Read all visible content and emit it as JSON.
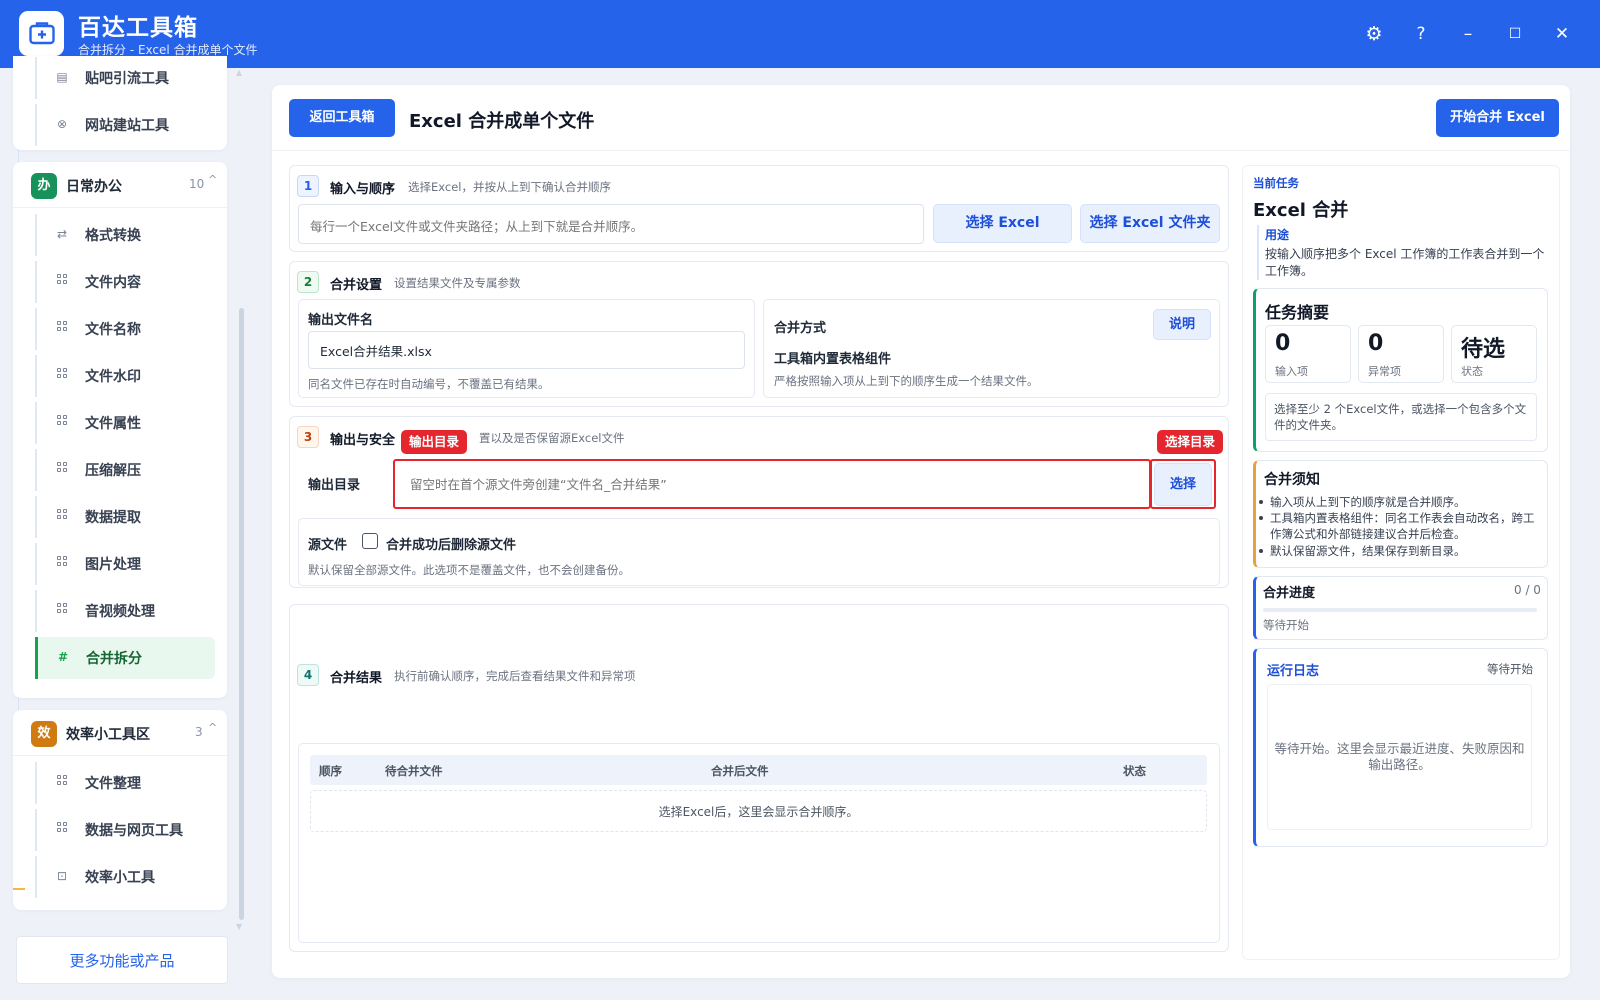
{
  "app": {
    "title": "百达工具箱",
    "subtitle": "合并拆分 - Excel 合并成单个文件"
  },
  "window_controls": {
    "settings": "⚙",
    "help": "?",
    "minimize": "–",
    "maximize": "☐",
    "close": "✕"
  },
  "sidebar": {
    "top_items": [
      "贴吧引流工具",
      "网站建站工具"
    ],
    "categories": [
      {
        "badge": "办",
        "badge_color": "#16925a",
        "name": "日常办公",
        "count": "10",
        "items": [
          "格式转换",
          "文件内容",
          "文件名称",
          "文件水印",
          "文件属性",
          "压缩解压",
          "数据提取",
          "图片处理",
          "音视频处理",
          "合并拆分"
        ],
        "active_item": "合并拆分"
      },
      {
        "badge": "效",
        "badge_color": "#d07b12",
        "name": "效率小工具区",
        "count": "3",
        "items": [
          "文件整理",
          "数据与网页工具",
          "效率小工具"
        ]
      }
    ],
    "more_button": "更多功能或产品"
  },
  "main": {
    "back_button": "返回工具箱",
    "title": "Excel 合并成单个文件",
    "start_button": "开始合并 Excel",
    "sections": {
      "input": {
        "num": "1",
        "title": "输入与顺序",
        "desc": "选择Excel，并按从上到下确认合并顺序",
        "placeholder": "每行一个Excel文件或文件夹路径；从上到下就是合并顺序。",
        "select_excel": "选择 Excel",
        "select_folder": "选择 Excel 文件夹"
      },
      "settings": {
        "num": "2",
        "title": "合并设置",
        "desc": "设置结果文件及专属参数",
        "output_name_label": "输出文件名",
        "output_name_value": "Excel合并结果.xlsx",
        "output_name_hint": "同名文件已存在时自动编号，不覆盖已有结果。",
        "method_label": "合并方式",
        "explain_button": "说明",
        "method_value": "工具箱内置表格组件",
        "method_hint": "严格按照输入项从上到下的顺序生成一个结果文件。"
      },
      "output": {
        "num": "3",
        "title": "输出与安全",
        "desc": "置以及是否保留源Excel文件",
        "tag_dir": "输出目录",
        "tag_select": "选择目录",
        "dir_label": "输出目录",
        "dir_placeholder": "留空时在首个源文件旁创建“文件名_合并结果”",
        "select_button": "选择",
        "source_label": "源文件",
        "delete_label": "合并成功后删除源文件",
        "source_hint": "默认保留全部源文件。此选项不是覆盖文件，也不会创建备份。"
      },
      "result": {
        "num": "4",
        "title": "合并结果",
        "desc": "执行前确认顺序，完成后查看结果文件和异常项",
        "columns": [
          "顺序",
          "待合并文件",
          "合并后文件",
          "状态"
        ],
        "empty": "选择Excel后，这里会显示合并顺序。"
      }
    }
  },
  "right_panel": {
    "current_task_label": "当前任务",
    "task_title": "Excel 合并",
    "usage_label": "用途",
    "usage_text": "按输入顺序把多个 Excel 工作簿的工作表合并到一个工作簿。",
    "summary_title": "任务摘要",
    "stats": [
      {
        "value": "0",
        "label": "输入项"
      },
      {
        "value": "0",
        "label": "异常项"
      },
      {
        "value": "待选",
        "label": "状态"
      }
    ],
    "summary_hint": "选择至少 2 个Excel文件，或选择一个包含多个文件的文件夹。",
    "notice_title": "合并须知",
    "notices": [
      "输入项从上到下的顺序就是合并顺序。",
      "工具箱内置表格组件：同名工作表会自动改名，跨工作簿公式和外部链接建议合并后检查。",
      "默认保留源文件，结果保存到新目录。"
    ],
    "progress_title": "合并进度",
    "progress_count": "0 / 0",
    "progress_value": 0,
    "progress_status": "等待开始",
    "log_title": "运行日志",
    "log_status": "等待开始",
    "log_placeholder": "等待开始。这里会显示最近进度、失败原因和输出路径。"
  }
}
